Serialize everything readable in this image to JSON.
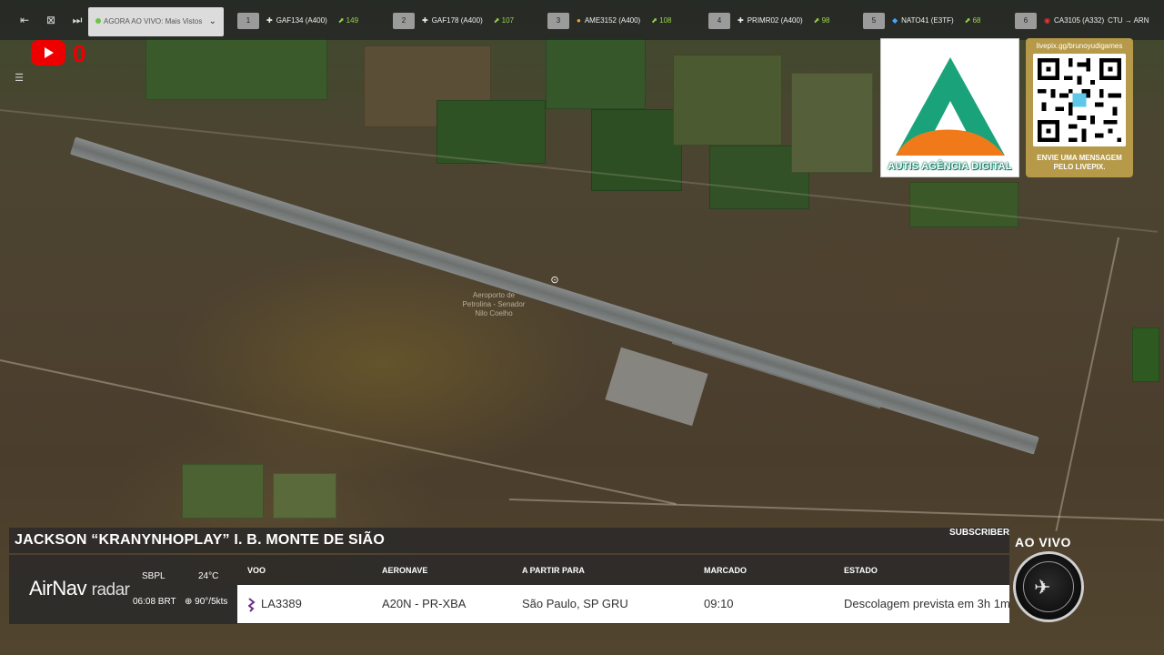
{
  "topbar": {
    "live_select": "AGORA AO VIVO: Mais Vistos",
    "flights": [
      {
        "num": "1",
        "callsign": "GAF134 (A400)",
        "count": "149"
      },
      {
        "num": "2",
        "callsign": "GAF178 (A400)",
        "count": "107"
      },
      {
        "num": "3",
        "callsign": "AME3152 (A400)",
        "count": "108"
      },
      {
        "num": "4",
        "callsign": "PRIMR02 (A400)",
        "count": "98"
      },
      {
        "num": "5",
        "callsign": "NATO41 (E3TF)",
        "count": "68"
      },
      {
        "num": "6",
        "callsign": "CA3105 (A332)",
        "count": "CTU → ARN"
      }
    ]
  },
  "youtube": {
    "count": "0"
  },
  "map": {
    "airport_label": "Aeroporto de Petrolina - Senador Nilo Coelho"
  },
  "sponsor": {
    "name": "AUTIS AGÊNCIA DIGITAL",
    "accent": "#1aa37a",
    "accent2": "#f07a1a"
  },
  "qr": {
    "url": "livepix.gg/brunoyudigames",
    "cta": "ENVIE UMA MENSAGEM PELO LIVEPIX."
  },
  "board": {
    "streamer": "JACKSON “KRANYNHOPLAY” I. B. MONTE DE SIÃO",
    "subscriber_label": "SUBSCRIBER",
    "brand": "AirNav",
    "brand_suffix": "radar",
    "weather": {
      "icao": "SBPL",
      "temp": "24°C",
      "time": "06:08 BRT",
      "wind": "90°/5kts"
    },
    "columns": {
      "flight": "VOO",
      "aircraft": "AERONAVE",
      "route": "A PARTIR PARA",
      "scheduled": "MARCADO",
      "status": "ESTADO"
    },
    "row": {
      "flight": "LA3389",
      "aircraft": "A20N - PR-XBA",
      "route": "São Paulo, SP GRU",
      "scheduled": "09:10",
      "status": "Descolagem prevista em 3h 1m"
    },
    "live_label": "AO VIVO"
  }
}
